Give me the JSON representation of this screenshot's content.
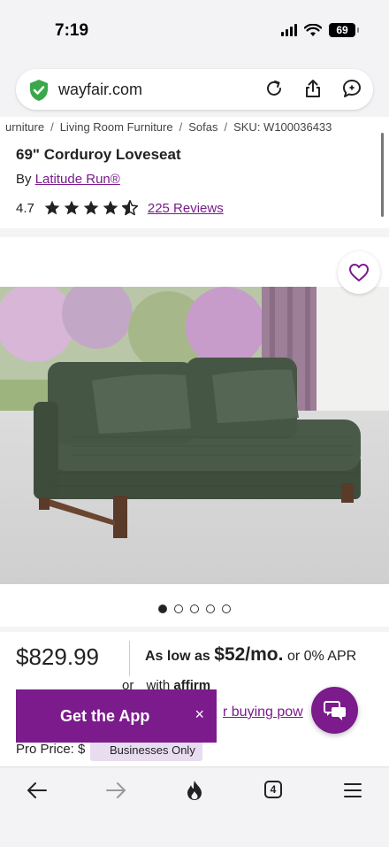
{
  "status_bar": {
    "time": "7:19",
    "battery": "69"
  },
  "browser": {
    "url": "wayfair.com"
  },
  "breadcrumb": [
    "urniture",
    "Living Room Furniture",
    "Sofas",
    "SKU: W100036433"
  ],
  "product": {
    "title": "69\" Corduroy Loveseat",
    "by_prefix": "By",
    "brand": "Latitude Run®",
    "rating": "4.7",
    "stars": 4.5,
    "reviews": "225 Reviews"
  },
  "gallery": {
    "image_count": 5,
    "active_index": 0
  },
  "pricing": {
    "price": "$829.99",
    "low_as_prefix": "As low as",
    "monthly": "$52/mo.",
    "apr": "or 0% APR",
    "or": "or",
    "with": "with",
    "affirm": "affirm",
    "buying_power": "r buying pow",
    "pro_price_label": "Pro Price: $",
    "businesses_only": "Businesses Only"
  },
  "app_banner": {
    "label": "Get the App",
    "close": "×"
  },
  "toolbar": {
    "tab_count": "4"
  },
  "colors": {
    "brand_purple": "#7b1b8c",
    "star": "#222222"
  },
  "icons": [
    "shield-check-icon",
    "reload-icon",
    "share-icon",
    "chat-plus-icon",
    "heart-icon",
    "chat-icon",
    "back-icon",
    "forward-icon",
    "flame-icon",
    "tabs-icon",
    "menu-icon"
  ]
}
